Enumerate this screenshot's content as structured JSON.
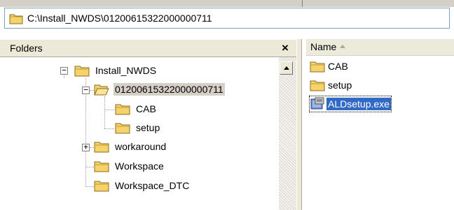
{
  "address_bar": {
    "path": "C:\\Install_NWDS\\01200615322000000711",
    "icon": "folder-icon"
  },
  "folders_pane": {
    "title": "Folders",
    "close_label": "×",
    "tree": [
      {
        "label": "Install_NWDS",
        "expander": "−",
        "expanded": true
      },
      {
        "label": "01200615322000000711",
        "expander": "−",
        "expanded": true,
        "selected": true,
        "open_folder": true
      },
      {
        "label": "CAB"
      },
      {
        "label": "setup"
      },
      {
        "label": "workaround",
        "expander": "+",
        "expanded": false
      },
      {
        "label": "Workspace"
      },
      {
        "label": "Workspace_DTC"
      }
    ]
  },
  "file_list": {
    "column_name": "Name",
    "items": [
      {
        "label": "CAB",
        "icon": "folder-icon"
      },
      {
        "label": "setup",
        "icon": "folder-icon"
      },
      {
        "label": "ALDsetup.exe",
        "icon": "setup-exe-icon",
        "selected": true
      }
    ]
  },
  "colors": {
    "folder_fill": "#f5d26b",
    "folder_edge": "#c49a2a",
    "selection_blue": "#316ac5",
    "selection_grey": "#d4d0c8"
  }
}
